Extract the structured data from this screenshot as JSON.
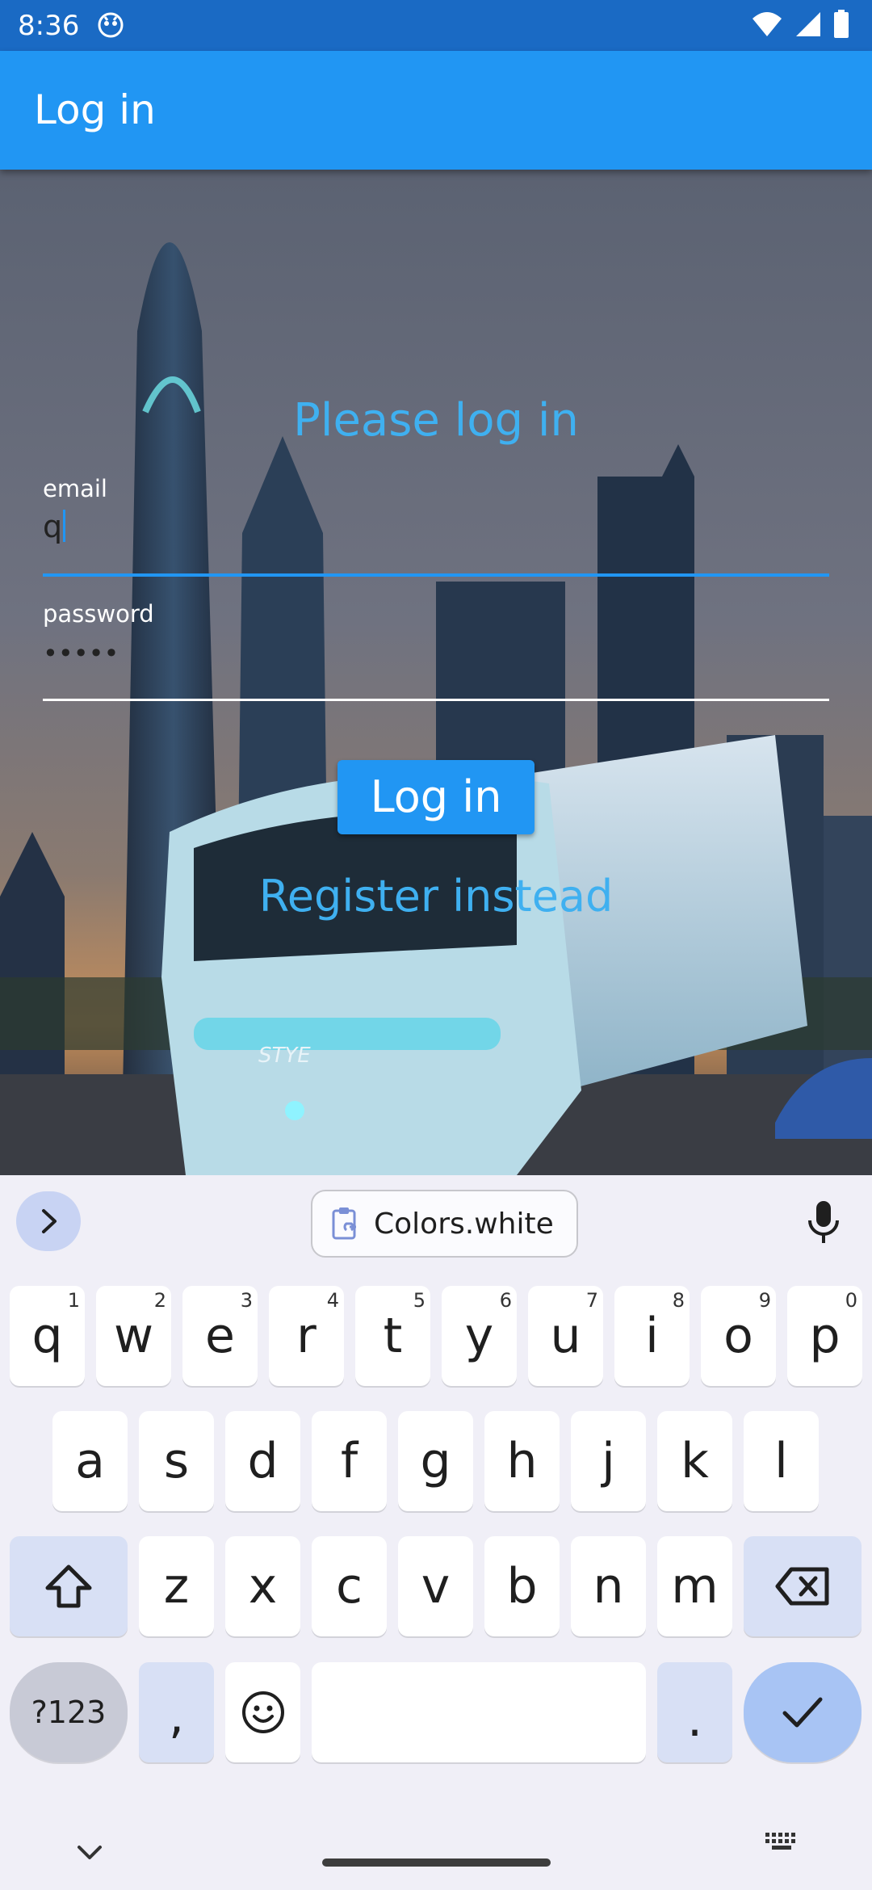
{
  "status_bar": {
    "time": "8:36"
  },
  "app_bar": {
    "title": "Log in"
  },
  "form": {
    "heading": "Please log in",
    "email": {
      "label": "email",
      "value": "q"
    },
    "password": {
      "label": "password",
      "value": "•••••"
    },
    "login_button": "Log in",
    "register_link": "Register instead"
  },
  "keyboard": {
    "clipboard_suggestion": "Colors.white",
    "row1": [
      {
        "key": "q",
        "hint": "1"
      },
      {
        "key": "w",
        "hint": "2"
      },
      {
        "key": "e",
        "hint": "3"
      },
      {
        "key": "r",
        "hint": "4"
      },
      {
        "key": "t",
        "hint": "5"
      },
      {
        "key": "y",
        "hint": "6"
      },
      {
        "key": "u",
        "hint": "7"
      },
      {
        "key": "i",
        "hint": "8"
      },
      {
        "key": "o",
        "hint": "9"
      },
      {
        "key": "p",
        "hint": "0"
      }
    ],
    "row2": [
      "a",
      "s",
      "d",
      "f",
      "g",
      "h",
      "j",
      "k",
      "l"
    ],
    "row3": [
      "z",
      "x",
      "c",
      "v",
      "b",
      "n",
      "m"
    ],
    "symbols_key": "?123",
    "comma_key": ",",
    "period_key": "."
  },
  "colors": {
    "app_bar": "#2196f3",
    "status_bar": "#1a6ac4",
    "accent_text": "#3fb0f0",
    "keyboard_bg": "#f0eff7",
    "func_key": "#d8e0f5",
    "enter_key": "#a8c4f4"
  },
  "icons": {
    "status": [
      "app-notification-icon",
      "wifi-icon",
      "signal-icon",
      "battery-icon"
    ],
    "keyboard": [
      "expand-toolbar-icon",
      "clipboard-icon",
      "microphone-icon",
      "shift-icon",
      "backspace-icon",
      "emoji-icon",
      "checkmark-icon",
      "hide-keyboard-icon",
      "keyboard-switch-icon"
    ]
  }
}
